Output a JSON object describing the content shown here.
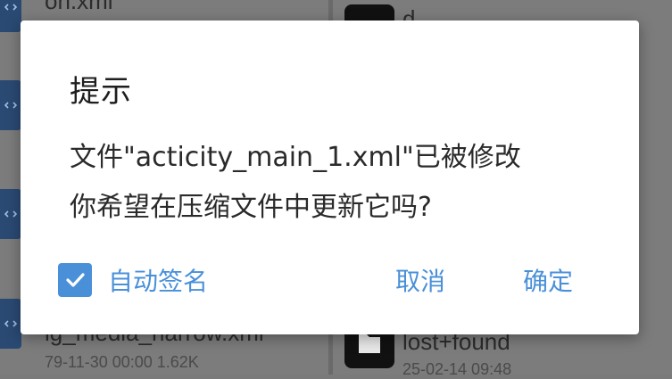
{
  "background": {
    "left_items": [
      {
        "name": "on.xml"
      },
      {
        "name": "ig_media_narrow.xml",
        "meta": "79-11-30 00:00  1.62K"
      }
    ],
    "right_items": [
      {
        "name": "d"
      },
      {
        "name": "lost+found",
        "meta": "25-02-14 09:48"
      }
    ]
  },
  "dialog": {
    "title": "提示",
    "message_line1": "文件\"acticity_main_1.xml\"已被修改",
    "message_line2": "你希望在压缩文件中更新它吗?",
    "checkbox_label": "自动签名",
    "checkbox_checked": true,
    "cancel_label": "取消",
    "ok_label": "确定"
  },
  "colors": {
    "accent": "#4a90d9",
    "dialog_bg": "#ffffff",
    "overlay": "#7c7c7c"
  }
}
